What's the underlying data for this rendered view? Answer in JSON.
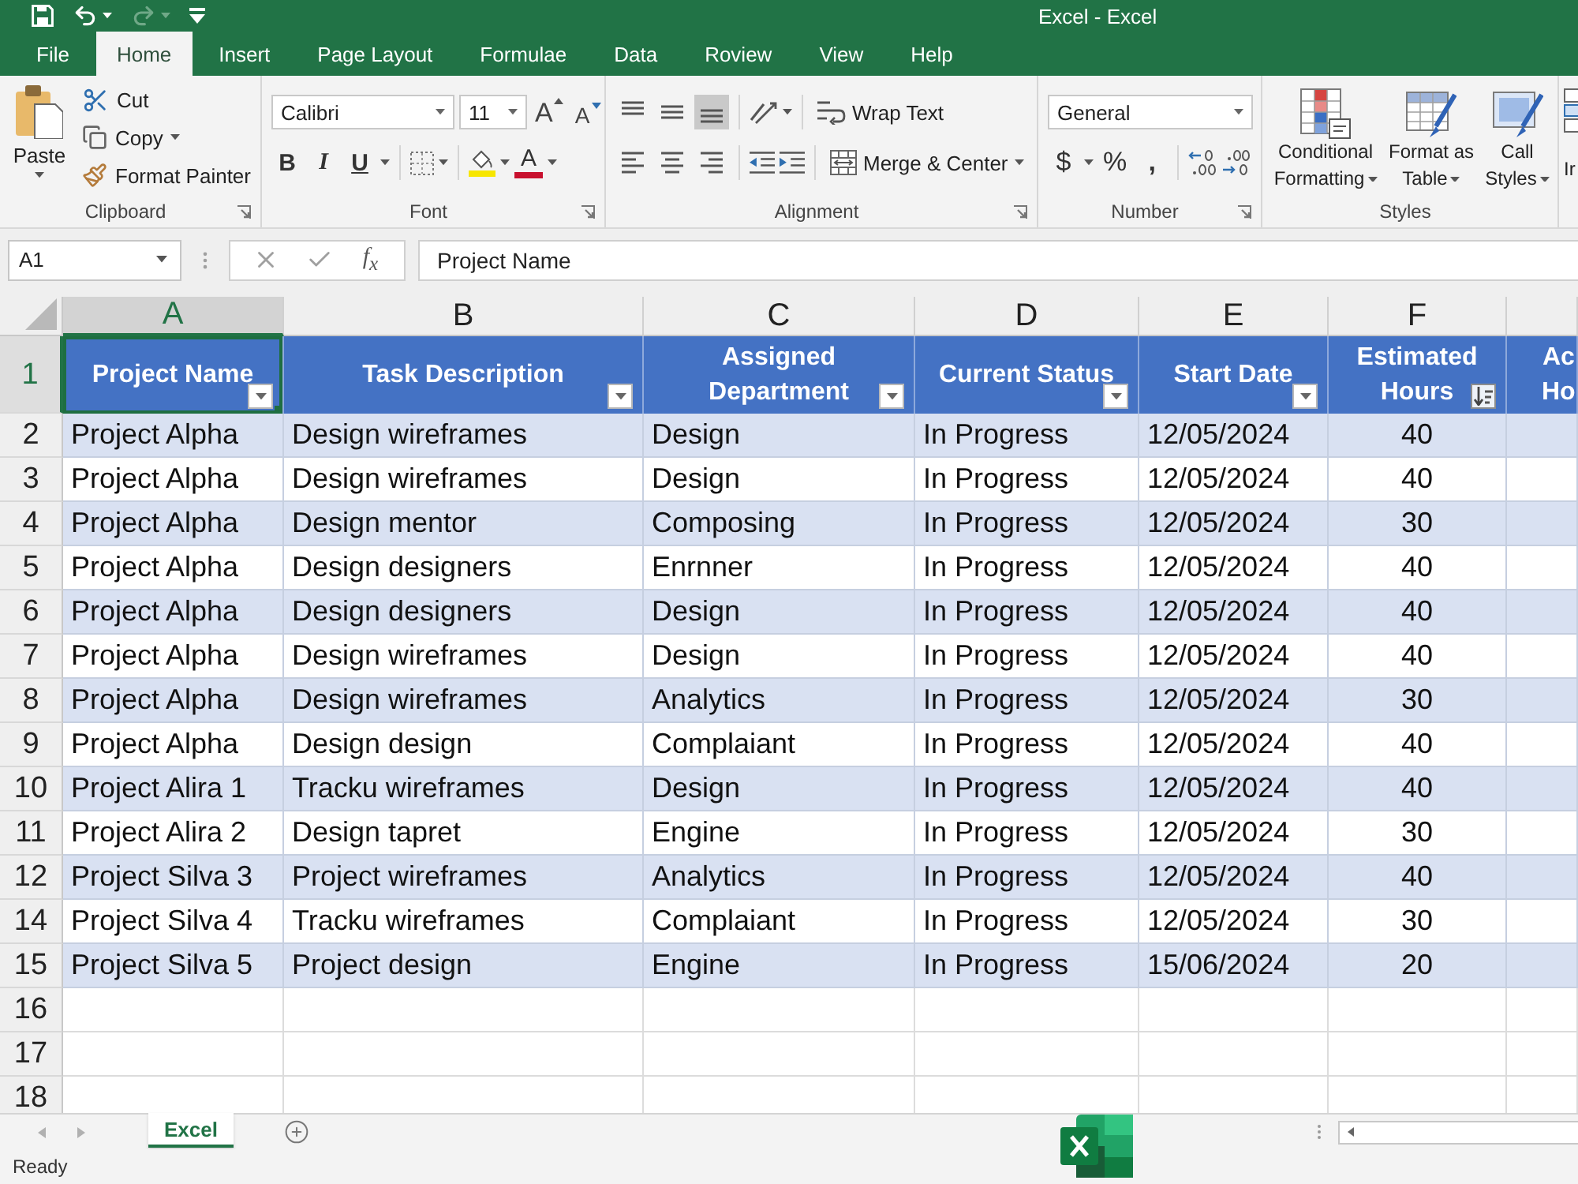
{
  "window": {
    "title": "Excel - Excel"
  },
  "quick_access": [
    {
      "kind": "save",
      "disabled": false
    },
    {
      "kind": "undo",
      "disabled": false
    },
    {
      "kind": "redo",
      "disabled": true
    },
    {
      "kind": "customize",
      "disabled": false
    }
  ],
  "tabs": [
    {
      "label": "File",
      "selected": false
    },
    {
      "label": "Home",
      "selected": true
    },
    {
      "label": "Insert",
      "selected": false
    },
    {
      "label": "Page Layout",
      "selected": false
    },
    {
      "label": "Formulae",
      "selected": false
    },
    {
      "label": "Data",
      "selected": false
    },
    {
      "label": "Roview",
      "selected": false
    },
    {
      "label": "View",
      "selected": false
    },
    {
      "label": "Help",
      "selected": false
    }
  ],
  "ribbon": {
    "clipboard": {
      "label": "Clipboard",
      "paste": "Paste",
      "actions": [
        {
          "kind": "cut",
          "label": "Cut"
        },
        {
          "kind": "copy",
          "label": "Copy"
        },
        {
          "kind": "format_painter",
          "label": "Format Painter"
        }
      ]
    },
    "font": {
      "label": "Font",
      "font_name": "Calibri",
      "font_size": "11",
      "grow": "A",
      "shrink": "A",
      "styles": [
        {
          "kind": "bold",
          "label": "B"
        },
        {
          "kind": "italic",
          "label": "I"
        },
        {
          "kind": "underline",
          "label": "U"
        }
      ],
      "font_color": "A"
    },
    "alignment": {
      "label": "Alignment",
      "vertical": [
        {
          "kind": "top",
          "selected": false
        },
        {
          "kind": "middle",
          "selected": false
        },
        {
          "kind": "bottom",
          "selected": true
        }
      ],
      "horizontal": [
        {
          "kind": "left",
          "selected": false
        },
        {
          "kind": "center",
          "selected": false
        },
        {
          "kind": "right",
          "selected": false
        }
      ],
      "wrap_text": "Wrap Text",
      "merge": "Merge & Center"
    },
    "number": {
      "label": "Number",
      "format": "General",
      "currency": "$",
      "percent": "%",
      "comma": ","
    },
    "styles": {
      "label": "Styles",
      "items": [
        {
          "kind": "conditional",
          "lines": [
            "Conditional",
            "Formatting"
          ]
        },
        {
          "kind": "table",
          "lines": [
            "Format as",
            "Table"
          ]
        },
        {
          "kind": "cell",
          "lines": [
            "Call",
            "Styles"
          ]
        }
      ]
    },
    "next_group_partial": "Ir"
  },
  "formula_bar": {
    "name_box": "A1",
    "function_label": "f$_{x}$",
    "formula": "Project Name"
  },
  "sheet": {
    "columns": [
      {
        "letter": "A",
        "lines": [
          "Project Name"
        ],
        "filter": true,
        "sorted": false,
        "kind": "text",
        "selected": true
      },
      {
        "letter": "B",
        "lines": [
          "Task Description"
        ],
        "filter": true,
        "sorted": false,
        "kind": "text",
        "selected": false
      },
      {
        "letter": "C",
        "lines": [
          "Assigned",
          "Department"
        ],
        "filter": true,
        "sorted": false,
        "kind": "text",
        "selected": false
      },
      {
        "letter": "D",
        "lines": [
          "Current Status"
        ],
        "filter": true,
        "sorted": false,
        "kind": "text",
        "selected": false
      },
      {
        "letter": "E",
        "lines": [
          "Start Date"
        ],
        "filter": true,
        "sorted": false,
        "kind": "text",
        "selected": false
      },
      {
        "letter": "F",
        "lines": [
          "Estimated",
          "Hours"
        ],
        "filter": true,
        "sorted": true,
        "kind": "number",
        "selected": false
      },
      {
        "lines": [
          "Ac",
          "Ho"
        ]
      }
    ],
    "header_row": {
      "number": "1",
      "selected": true
    },
    "banded_rows": true,
    "rows": [
      {
        "number": "2",
        "cells": [
          "Project Alpha",
          "Design wireframes",
          "Design",
          "In Progress",
          "12/05/2024",
          "40"
        ]
      },
      {
        "number": "3",
        "cells": [
          "Project Alpha",
          "Design wireframes",
          "Design",
          "In Progress",
          "12/05/2024",
          "40"
        ]
      },
      {
        "number": "4",
        "cells": [
          "Project Alpha",
          "Design mentor",
          "Composing",
          "In Progress",
          "12/05/2024",
          "30"
        ]
      },
      {
        "number": "5",
        "cells": [
          "Project Alpha",
          "Design designers",
          "Enrnner",
          "In Progress",
          "12/05/2024",
          "40"
        ]
      },
      {
        "number": "6",
        "cells": [
          "Project Alpha",
          "Design designers",
          "Design",
          "In Progress",
          "12/05/2024",
          "40"
        ]
      },
      {
        "number": "7",
        "cells": [
          "Project Alpha",
          "Design wireframes",
          "Design",
          "In Progress",
          "12/05/2024",
          "40"
        ]
      },
      {
        "number": "8",
        "cells": [
          "Project Alpha",
          "Design wireframes",
          "Analytics",
          "In Progress",
          "12/05/2024",
          "30"
        ]
      },
      {
        "number": "9",
        "cells": [
          "Project Alpha",
          "Design design",
          "Complaiant",
          "In Progress",
          "12/05/2024",
          "40"
        ]
      },
      {
        "number": "10",
        "cells": [
          "Project Alira 1",
          "Tracku wireframes",
          "Design",
          "In Progress",
          "12/05/2024",
          "40"
        ]
      },
      {
        "number": "11",
        "cells": [
          "Project Alira 2",
          "Design tapret",
          "Engine",
          "In Progress",
          "12/05/2024",
          "30"
        ]
      },
      {
        "number": "12",
        "cells": [
          "Project Silva 3",
          "Project wireframes",
          "Analytics",
          "In Progress",
          "12/05/2024",
          "40"
        ]
      },
      {
        "number": "14",
        "cells": [
          "Project Silva 4",
          "Tracku wireframes",
          "Complaiant",
          "In Progress",
          "12/05/2024",
          "30"
        ]
      },
      {
        "number": "15",
        "cells": [
          "Project Silva 5",
          "Project design",
          "Engine",
          "In Progress",
          "15/06/2024",
          "20"
        ]
      }
    ],
    "empty_rows": [
      "16",
      "17",
      "18"
    ]
  },
  "sheet_tabs": [
    {
      "label": "Excel",
      "selected": true
    }
  ],
  "status_bar": {
    "text": "Ready"
  }
}
